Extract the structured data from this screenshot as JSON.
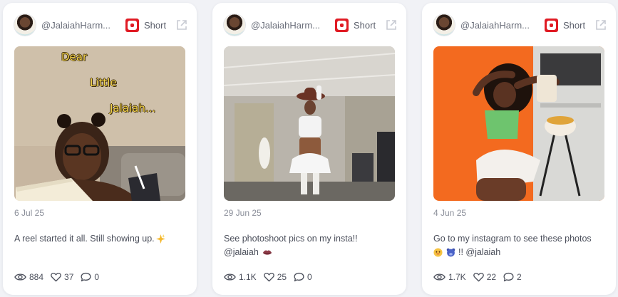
{
  "posts": [
    {
      "author_handle": "@JalaiahHarm...",
      "platform_icon": "youtube-icon",
      "type_label": "Short",
      "thumb_caption_lines": [
        "Dear",
        "Little",
        "Jalaiah..."
      ],
      "date": "6 Jul 25",
      "caption_text": "A reel started it all. Still showing up.",
      "caption_emoji": "sparkles-emoji",
      "caption_line2": "",
      "views": "884",
      "likes": "37",
      "comments": "0"
    },
    {
      "author_handle": "@JalaiahHarm...",
      "platform_icon": "youtube-icon",
      "type_label": "Short",
      "date": "29 Jun 25",
      "caption_text": "See photoshoot pics on my insta!!",
      "caption_line2": "@jalaiah",
      "caption_emoji": "lips-emoji",
      "views": "1.1K",
      "likes": "25",
      "comments": "0"
    },
    {
      "author_handle": "@JalaiahHarm...",
      "platform_icon": "youtube-icon",
      "type_label": "Short",
      "date": "4 Jun 25",
      "caption_text": "Go to my instagram to see these photos",
      "caption_line2": "!! @jalaiah",
      "caption_emoji": "smiling-face-and-bear-emoji",
      "views": "1.7K",
      "likes": "22",
      "comments": "2"
    }
  ],
  "colors": {
    "page_background": "#f1f2f6",
    "card_background": "#ffffff",
    "youtube_red": "#e01b24",
    "text_muted": "#8a8e99",
    "text_body": "#4a4e5a",
    "thumb_caption_yellow": "#f6d64a"
  }
}
